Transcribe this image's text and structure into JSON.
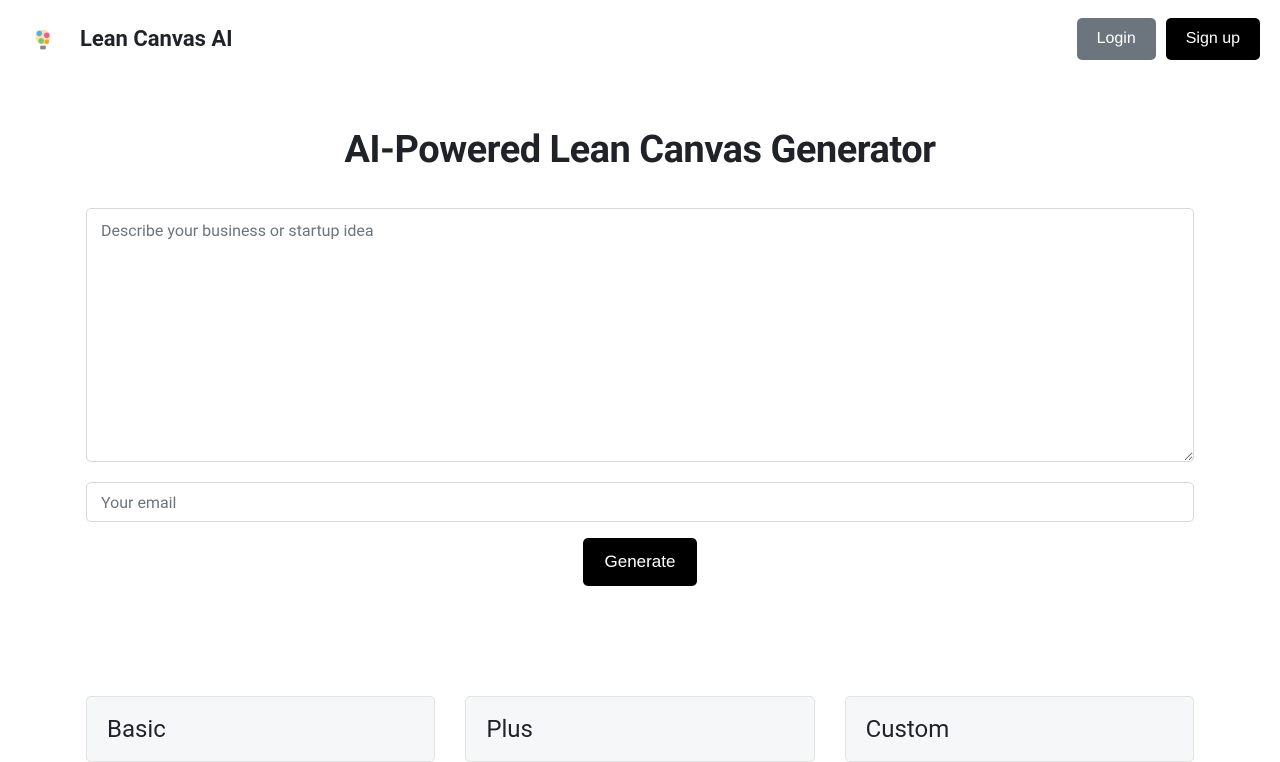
{
  "header": {
    "brand_name": "Lean Canvas AI",
    "login_label": "Login",
    "signup_label": "Sign up"
  },
  "main": {
    "title": "AI-Powered Lean Canvas Generator",
    "idea_placeholder": "Describe your business or startup idea",
    "email_placeholder": "Your email",
    "generate_label": "Generate"
  },
  "plans": [
    {
      "name": "Basic"
    },
    {
      "name": "Plus"
    },
    {
      "name": "Custom"
    }
  ]
}
